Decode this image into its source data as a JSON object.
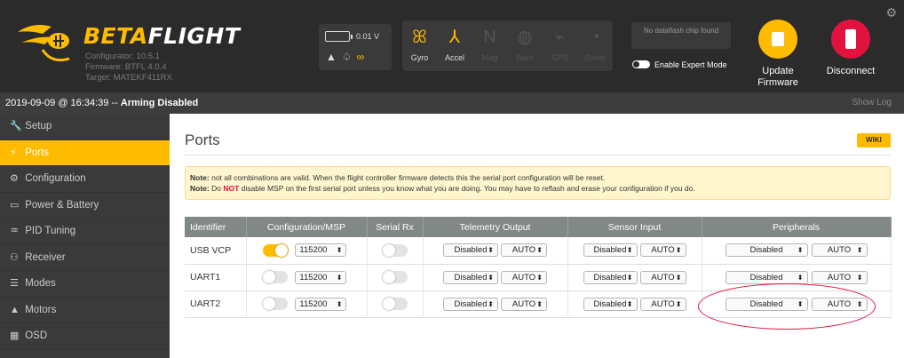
{
  "header": {
    "brand_part1": "BETA",
    "brand_part2": "FLIGHT",
    "configurator": "Configurator: 10.5.1",
    "firmware": "Firmware: BTFL 4.0.4",
    "target": "Target: MATEKF411RX",
    "battery_voltage": "0.01 V",
    "sensors": [
      {
        "label": "Gyro",
        "icon": "gyro-icon",
        "glyph": "ꕤ",
        "active": true
      },
      {
        "label": "Accel",
        "icon": "accel-icon",
        "glyph": "⅄",
        "active": true
      },
      {
        "label": "Mag",
        "icon": "mag-icon",
        "glyph": "N",
        "active": false
      },
      {
        "label": "Baro",
        "icon": "baro-icon",
        "glyph": "◍",
        "active": false
      },
      {
        "label": "GPS",
        "icon": "gps-icon",
        "glyph": "⌁",
        "active": false
      },
      {
        "label": "Sonar",
        "icon": "sonar-icon",
        "glyph": "◔",
        "active": false
      }
    ],
    "dataflash_status": "No dataflash chip found",
    "expert_mode_label": "Enable Expert Mode",
    "update_firmware_label": "Update Firmware",
    "disconnect_label": "Disconnect",
    "accent_color": "#ffbb00",
    "disconnect_color": "#e2123f"
  },
  "statusbar": {
    "timestamp": "2019-09-09 @ 16:34:39 -- ",
    "arming": "Arming Disabled",
    "show_log": "Show Log"
  },
  "sidebar": {
    "items": [
      {
        "label": "Setup",
        "icon": "wrench-icon",
        "glyph": "🔧",
        "active": false
      },
      {
        "label": "Ports",
        "icon": "ports-icon",
        "glyph": "⚡",
        "active": true
      },
      {
        "label": "Configuration",
        "icon": "gear-icon",
        "glyph": "⚙",
        "active": false
      },
      {
        "label": "Power & Battery",
        "icon": "battery-icon",
        "glyph": "▭",
        "active": false
      },
      {
        "label": "PID Tuning",
        "icon": "pid-icon",
        "glyph": "♒",
        "active": false
      },
      {
        "label": "Receiver",
        "icon": "receiver-icon",
        "glyph": "⚇",
        "active": false
      },
      {
        "label": "Modes",
        "icon": "modes-icon",
        "glyph": "☰",
        "active": false
      },
      {
        "label": "Motors",
        "icon": "motors-icon",
        "glyph": "▲",
        "active": false
      },
      {
        "label": "OSD",
        "icon": "osd-icon",
        "glyph": "▦",
        "active": false
      }
    ]
  },
  "main": {
    "title": "Ports",
    "wiki_label": "WIKI",
    "note1_label": "Note:",
    "note1_text": " not all combinations are valid. When the flight controller firmware detects this the serial port configuration will be reset.",
    "note2_label": "Note:",
    "note2_pre": " Do ",
    "note2_not": "NOT",
    "note2_text": " disable MSP on the first serial port unless you know what you are doing. You may have to reflash and erase your configuration if you do.",
    "columns": [
      "Identifier",
      "Configuration/MSP",
      "Serial Rx",
      "Telemetry Output",
      "Sensor Input",
      "Peripherals"
    ],
    "rows": [
      {
        "id": "USB VCP",
        "msp": true,
        "baud": "115200",
        "serial_rx": false,
        "telemetry": "Disabled",
        "telemetry_baud": "AUTO",
        "sensor": "Disabled",
        "sensor_baud": "AUTO",
        "peripherals": "Disabled",
        "peripherals_baud": "AUTO"
      },
      {
        "id": "UART1",
        "msp": false,
        "baud": "115200",
        "serial_rx": false,
        "telemetry": "Disabled",
        "telemetry_baud": "AUTO",
        "sensor": "Disabled",
        "sensor_baud": "AUTO",
        "peripherals": "Disabled",
        "peripherals_baud": "AUTO"
      },
      {
        "id": "UART2",
        "msp": false,
        "baud": "115200",
        "serial_rx": false,
        "telemetry": "Disabled",
        "telemetry_baud": "AUTO",
        "sensor": "Disabled",
        "sensor_baud": "AUTO",
        "peripherals": "Disabled",
        "peripherals_baud": "AUTO"
      }
    ],
    "annotation_color": "#e2123f"
  }
}
